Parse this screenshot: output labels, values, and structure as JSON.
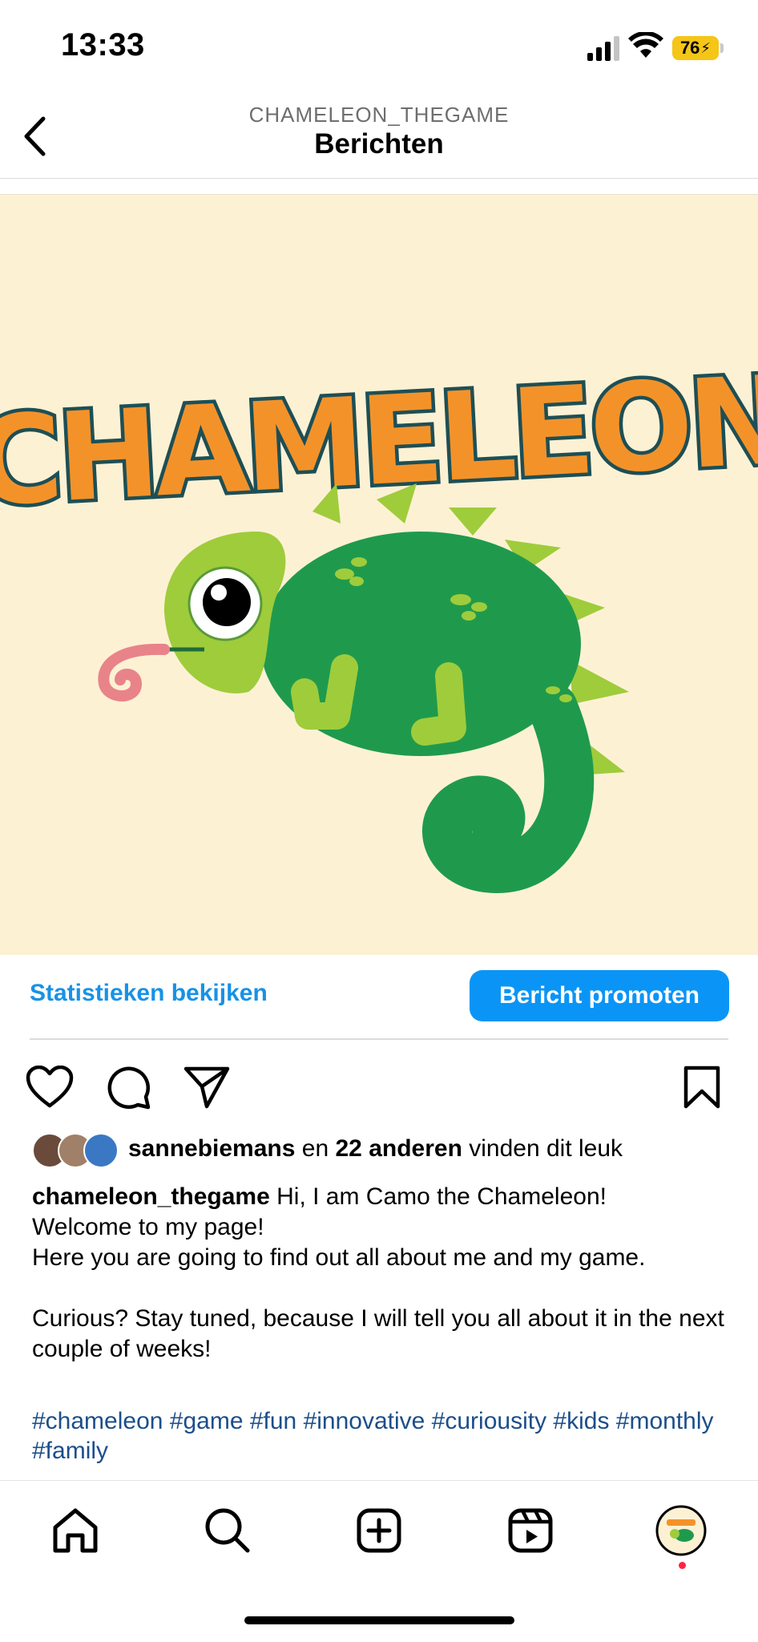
{
  "status_bar": {
    "time": "13:33",
    "battery": "76"
  },
  "header": {
    "account": "CHAMELEON_THEGAME",
    "title": "Berichten"
  },
  "post": {
    "image_title": "CHAMELEON",
    "stats_link": "Statistieken bekijken",
    "promote_button": "Bericht promoten",
    "likes": {
      "user": "sannebiemans",
      "connector": "en",
      "others": "22 anderen",
      "suffix": "vinden dit leuk"
    },
    "caption": {
      "username": "chameleon_thegame",
      "line1": "Hi, I am Camo the Chameleon!",
      "line2": "Welcome to my page!",
      "line3": "Here you are going to find out all about me and my game.",
      "line4": "Curious? Stay tuned, because I will tell you all about it in the next couple of weeks!"
    },
    "hashtags": "#chameleon #game #fun #innovative #curiousity #kids #monthly #family"
  },
  "icons": [
    "chevron-left-icon",
    "heart-icon",
    "comment-icon",
    "share-icon",
    "bookmark-icon",
    "home-icon",
    "search-icon",
    "create-icon",
    "reels-icon",
    "profile-avatar"
  ],
  "colors": {
    "accent": "#0a95f6",
    "link": "#1892e6",
    "hashtag": "#1c4e8a",
    "image_bg": "#fdf1d4",
    "battery": "#f5c518"
  }
}
